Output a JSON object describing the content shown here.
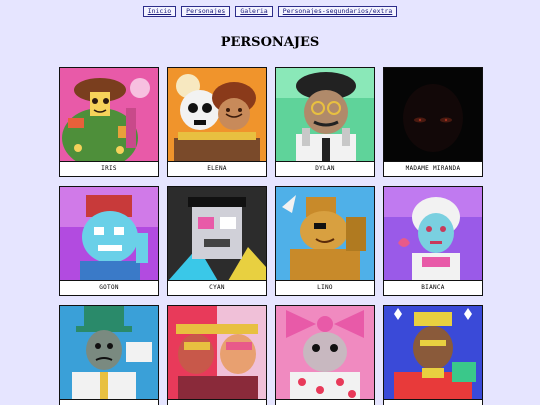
{
  "nav": {
    "items": [
      {
        "label": "Inicio"
      },
      {
        "label": "Personajes"
      },
      {
        "label": "Galeria"
      },
      {
        "label": "Personajes-segundarios/extra"
      }
    ]
  },
  "page": {
    "title": "PERSONAJES"
  },
  "characters": [
    {
      "name": "IRIS",
      "icon": "iris-portrait-icon",
      "bg": "#e85aa8"
    },
    {
      "name": "ELENA",
      "icon": "elena-portrait-icon",
      "bg": "#f0942c"
    },
    {
      "name": "DYLAN",
      "icon": "dylan-portrait-icon",
      "bg": "#5fd39a"
    },
    {
      "name": "MADAME MIRANDA",
      "icon": "madame-miranda-portrait-icon",
      "bg": "#050505"
    },
    {
      "name": "GOTON",
      "icon": "goton-portrait-icon",
      "bg": "#b24be0"
    },
    {
      "name": "CYAN",
      "icon": "cyan-portrait-icon",
      "bg": "#2c2c2c"
    },
    {
      "name": "LINO",
      "icon": "lino-portrait-icon",
      "bg": "#4fb0e8"
    },
    {
      "name": "BIANCA",
      "icon": "bianca-portrait-icon",
      "bg": "#9a5ae8"
    },
    {
      "name": "",
      "icon": "doctor-portrait-icon",
      "bg": "#3aa0d8"
    },
    {
      "name": "",
      "icon": "masked-duo-portrait-icon",
      "bg": "#e83a5a"
    },
    {
      "name": "",
      "icon": "clown-portrait-icon",
      "bg": "#f08ac0"
    },
    {
      "name": "",
      "icon": "king-portrait-icon",
      "bg": "#3a4ad8"
    }
  ]
}
